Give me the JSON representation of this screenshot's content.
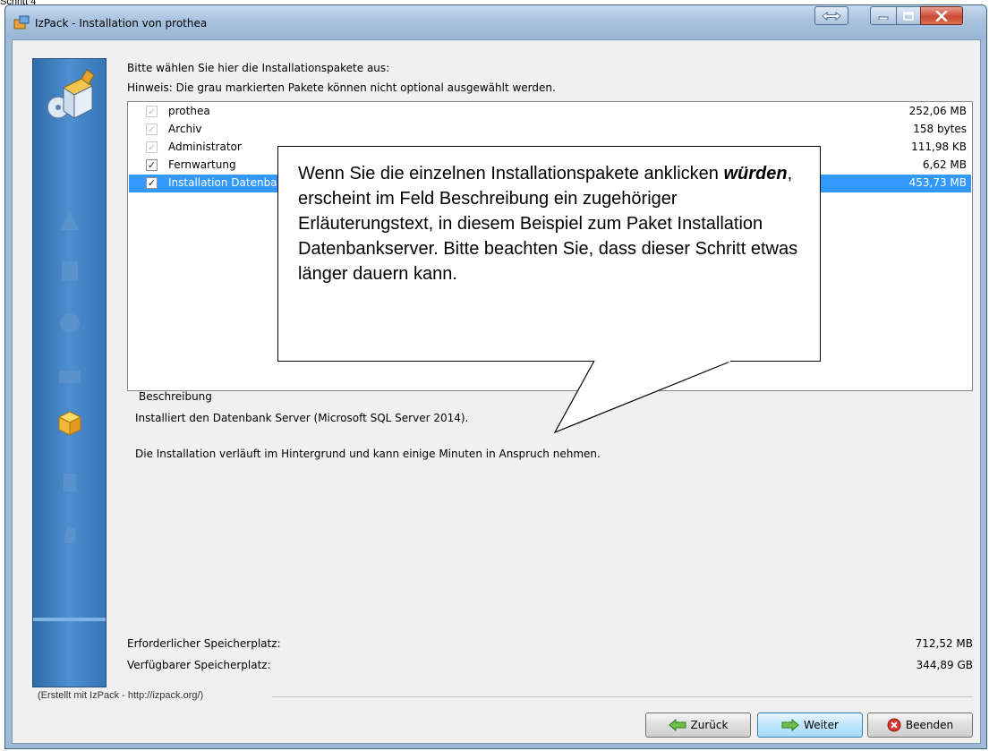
{
  "doc_label": "Schritt 4",
  "window": {
    "title": "IzPack - Installation von prothea"
  },
  "main": {
    "intro_line1": "Bitte wählen Sie hier die Installationspakete aus:",
    "intro_line2": "Hinweis: Die grau markierten Pakete können nicht optional ausgewählt werden.",
    "packages": [
      {
        "name": "prothea",
        "size": "252,06 MB",
        "checked": true,
        "disabled": true,
        "selected": false
      },
      {
        "name": "Archiv",
        "size": "158 bytes",
        "checked": true,
        "disabled": true,
        "selected": false
      },
      {
        "name": "Administrator",
        "size": "111,98 KB",
        "checked": true,
        "disabled": true,
        "selected": false
      },
      {
        "name": "Fernwartung",
        "size": "6,62 MB",
        "checked": true,
        "disabled": false,
        "selected": false
      },
      {
        "name": "Installation Datenbankserver",
        "size": "453,73 MB",
        "checked": true,
        "disabled": false,
        "selected": true
      }
    ],
    "description": {
      "label": "Beschreibung",
      "line1": "Installiert den Datenbank Server (Microsoft SQL Server 2014).",
      "line2": "Die Installation verläuft im Hintergrund und kann einige Minuten in Anspruch nehmen."
    },
    "required_space_label": "Erforderlicher Speicherplatz:",
    "required_space_value": "712,52 MB",
    "available_space_label": "Verfügbarer Speicherplatz:",
    "available_space_value": "344,89 GB"
  },
  "footer": {
    "credit": "(Erstellt mit IzPack - http://izpack.org/)",
    "back_label": "Zurück",
    "next_label": "Weiter",
    "quit_label": "Beenden"
  },
  "callout": {
    "part1": "Wenn Sie die einzelnen Installationspakete anklicken ",
    "emphasis": "würden",
    "part2": ", erscheint im Feld Beschreibung ein zugehöriger Erläuterungstext, in diesem Beispiel zum Paket Installation Datenbankserver. Bitte beachten Sie, dass dieser Schritt etwas länger dauern kann."
  },
  "colors": {
    "selection": "#3399ff",
    "sidebar": "#3f7fc0",
    "close_button": "#c94a35"
  }
}
